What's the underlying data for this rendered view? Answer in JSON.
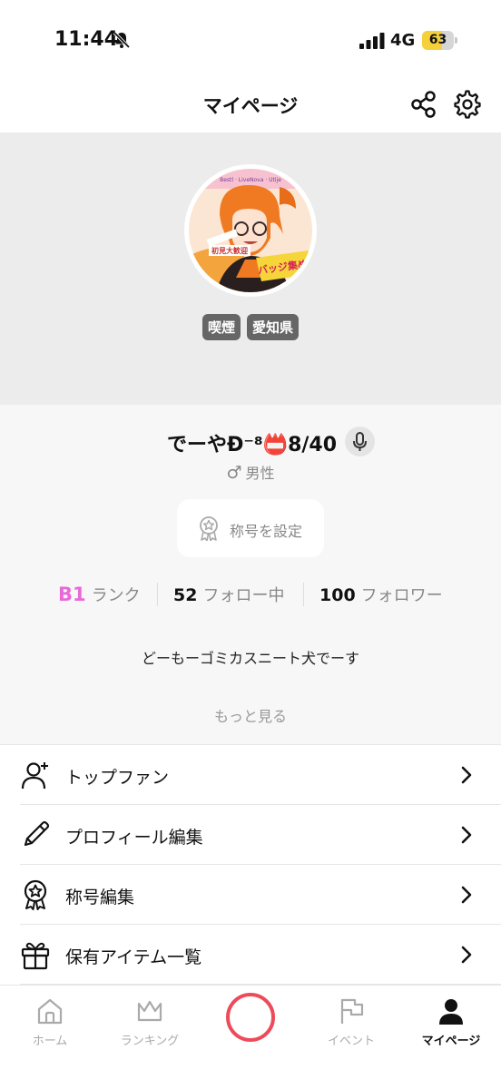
{
  "status_bar": {
    "time": "11:44",
    "network": "4G",
    "battery": "63",
    "battery_level": 0.63,
    "icons": [
      "bell-slash-icon",
      "signal-icon",
      "battery-icon"
    ]
  },
  "header": {
    "title": "マイページ",
    "icons": [
      "share-icon",
      "gear-icon"
    ]
  },
  "profile": {
    "tags": [
      "喫煙",
      "愛知県"
    ],
    "name": "でーやĐ⁻⁸📛8/40",
    "gender_symbol": "♂",
    "gender": "男性",
    "title_button": "称号を設定",
    "stats": {
      "rank_value": "B1",
      "rank_label": "ランク",
      "following_value": "52",
      "following_label": "フォロー中",
      "followers_value": "100",
      "followers_label": "フォロワー"
    },
    "bio": "どーもーゴミカスニート犬でーす",
    "more": "もっと見る"
  },
  "menu": [
    {
      "label": "トップファン",
      "icon": "user-plus-icon"
    },
    {
      "label": "プロフィール編集",
      "icon": "pencil-icon"
    },
    {
      "label": "称号編集",
      "icon": "badge-icon"
    },
    {
      "label": "保有アイテム一覧",
      "icon": "gift-icon"
    }
  ],
  "tabbar": {
    "home": "ホーム",
    "ranking": "ランキング",
    "event": "イベント",
    "mypage": "マイページ",
    "active": "マイページ"
  },
  "colors": {
    "accent_pink": "#e86ad8",
    "record_red": "#ee4a5a",
    "battery_yellow": "#f5d03b"
  }
}
